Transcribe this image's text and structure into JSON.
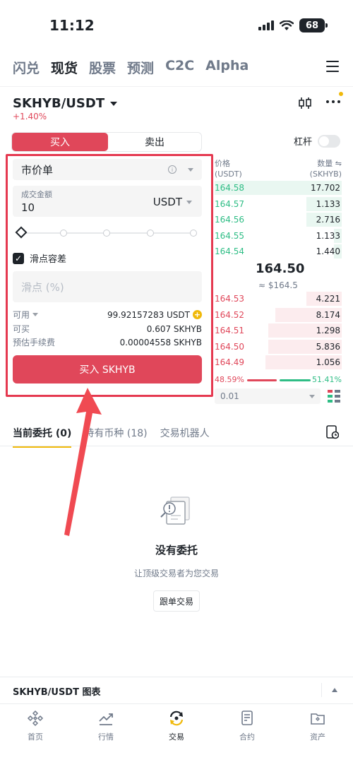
{
  "status": {
    "time": "11:12",
    "battery": "68"
  },
  "top_tabs": [
    "闪兑",
    "现货",
    "股票",
    "预测",
    "C2C",
    "Alpha"
  ],
  "pair": {
    "name": "SKHYB/USDT",
    "change": "+1.40%"
  },
  "trade": {
    "buy_tab": "买入",
    "sell_tab": "卖出",
    "leverage_label": "杠杆",
    "order_type": "市价单",
    "amount_label": "成交金额",
    "amount_value": "10",
    "amount_unit": "USDT",
    "slippage_label": "滑点容差",
    "slippage_placeholder": "滑点 (%)",
    "available_label": "可用",
    "available_value": "99.92157283 USDT",
    "can_buy_label": "可买",
    "can_buy_value": "0.607 SKHYB",
    "fee_label": "预估手续费",
    "fee_value": "0.00004558 SKHYB",
    "buy_button": "买入 SKHYB"
  },
  "orderbook": {
    "price_header": "价格",
    "price_unit": "(USDT)",
    "qty_header": "数量 ⇋",
    "qty_unit": "(SKHYB)",
    "asks": [
      {
        "price": "164.58",
        "qty": "17.702",
        "depth": 1.0
      },
      {
        "price": "164.57",
        "qty": "1.133",
        "depth": 0.28
      },
      {
        "price": "164.56",
        "qty": "2.716",
        "depth": 0.28
      },
      {
        "price": "164.55",
        "qty": "1.133",
        "depth": 0.06
      },
      {
        "price": "164.54",
        "qty": "1.440",
        "depth": 0.06
      }
    ],
    "mid_price": "164.50",
    "mid_sub": "≈ $164.5",
    "bids": [
      {
        "price": "164.53",
        "qty": "4.221",
        "depth": 0.28
      },
      {
        "price": "164.52",
        "qty": "8.174",
        "depth": 0.52
      },
      {
        "price": "164.51",
        "qty": "1.298",
        "depth": 0.58
      },
      {
        "price": "164.50",
        "qty": "5.836",
        "depth": 0.58
      },
      {
        "price": "164.49",
        "qty": "1.056",
        "depth": 0.6
      }
    ],
    "buy_ratio": "48.59%",
    "sell_ratio": "51.41%",
    "precision": "0.01"
  },
  "bottom_tabs": {
    "current_orders": "当前委托 (0)",
    "holdings": "持有币种 (18)",
    "bots": "交易机器人"
  },
  "empty": {
    "title": "没有委托",
    "subtitle": "让顶级交易者为您交易",
    "copy_button": "跟单交易"
  },
  "chart_bar": {
    "title": "SKHYB/USDT 图表"
  },
  "nav": [
    "首页",
    "行情",
    "交易",
    "合约",
    "资产"
  ],
  "colors": {
    "buy": "#e0475a",
    "sell": "#2ebd85",
    "accent": "#f0b90b",
    "annotation": "#e53950"
  }
}
